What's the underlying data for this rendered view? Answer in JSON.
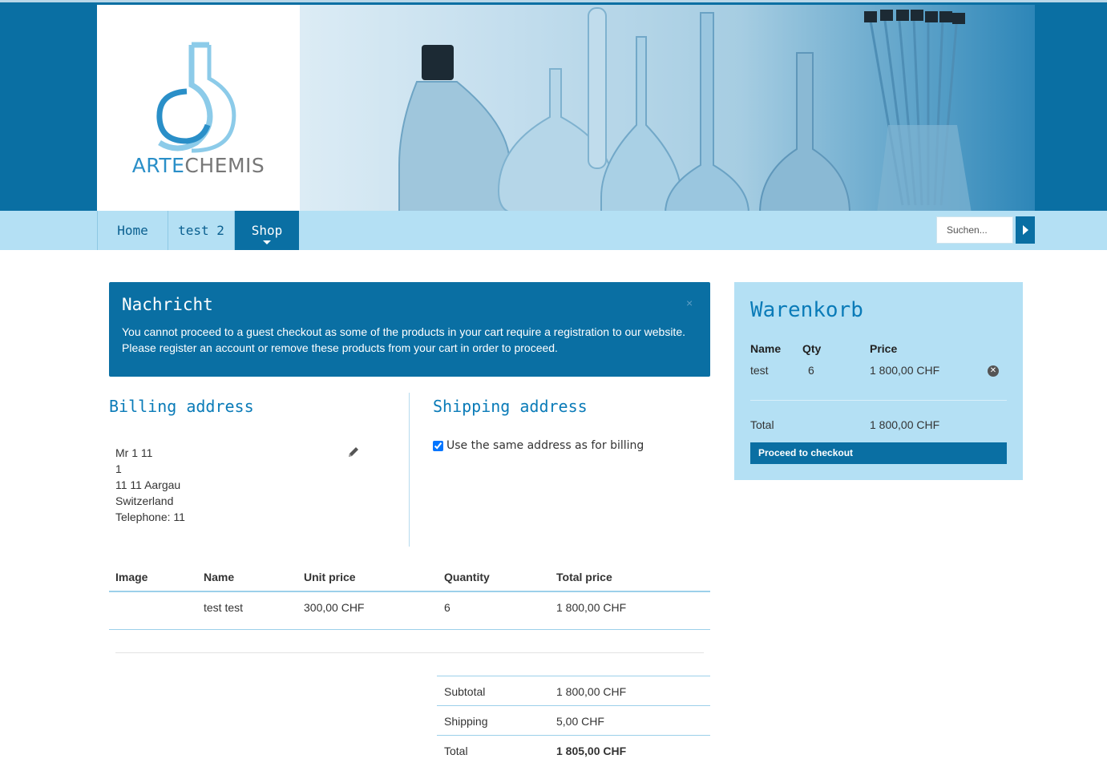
{
  "brand": {
    "logo_part1": "ARTE",
    "logo_part2": "CHEMIS"
  },
  "nav": {
    "items": [
      "Home",
      "test 2",
      "Shop"
    ],
    "active": "Shop"
  },
  "search": {
    "placeholder": "Suchen..."
  },
  "message": {
    "title": "Nachricht",
    "close": "×",
    "text": "You cannot proceed to a guest checkout as some of the products in your cart require a registration to our website. Please register an account or remove these products from your cart in order to proceed."
  },
  "billing": {
    "title": "Billing address",
    "lines": [
      "Mr 1 11",
      "1",
      "11 11 Aargau",
      "Switzerland",
      "Telephone: 11"
    ]
  },
  "shipping": {
    "title": "Shipping address",
    "same_as_billing_label": "Use the same address as for billing",
    "same_as_billing_checked": true
  },
  "order_table": {
    "headers": [
      "Image",
      "Name",
      "Unit price",
      "Quantity",
      "Total price"
    ],
    "rows": [
      {
        "image": "",
        "name": "test test",
        "unit_price": "300,00 CHF",
        "quantity": "6",
        "total_price": "1 800,00 CHF"
      }
    ]
  },
  "totals": [
    {
      "label": "Subtotal",
      "value": "1 800,00 CHF"
    },
    {
      "label": "Shipping",
      "value": "5,00 CHF"
    },
    {
      "label": "Total",
      "value": "1 805,00 CHF"
    }
  ],
  "cart": {
    "title": "Warenkorb",
    "headers": {
      "name": "Name",
      "qty": "Qty",
      "price": "Price"
    },
    "items": [
      {
        "name": "test",
        "qty": "6",
        "price": "1 800,00 CHF"
      }
    ],
    "total_label": "Total",
    "total_value": "1 800,00 CHF",
    "checkout_label": "Proceed to checkout"
  },
  "colors": {
    "brand_blue": "#0a6fa3",
    "light_blue": "#b4e0f4",
    "link": "#2a8fc8"
  }
}
